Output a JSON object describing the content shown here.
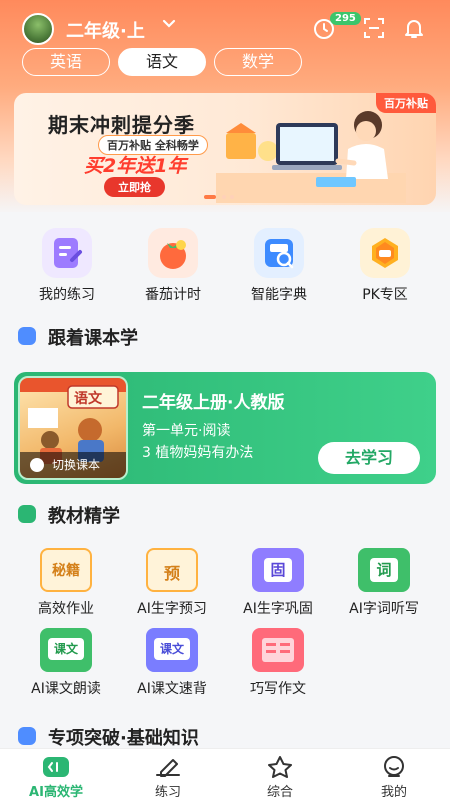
{
  "header": {
    "grade": "二年级·上",
    "coin_count": "295"
  },
  "subject_tabs": [
    {
      "label": "英语",
      "active": false
    },
    {
      "label": "语文",
      "active": true
    },
    {
      "label": "数学",
      "active": false
    }
  ],
  "banner": {
    "tag": "百万补贴",
    "title": "期末冲刺提分季",
    "subtitle": "百万补贴  全科畅学",
    "promo": "买2年送1年",
    "button": "立即抢"
  },
  "quick_actions": [
    {
      "label": "我的练习",
      "icon": "practice-icon",
      "color": "#9d7bff"
    },
    {
      "label": "番茄计时",
      "icon": "tomato-timer-icon",
      "color": "#ff6a3d"
    },
    {
      "label": "智能字典",
      "icon": "dictionary-icon",
      "color": "#3d8bff"
    },
    {
      "label": "PK专区",
      "icon": "pk-icon",
      "color": "#ffb020"
    }
  ],
  "textbook_section": {
    "title": "跟着课本学",
    "cover_title": "语文",
    "switch_label": "切换课本",
    "book_title": "二年级上册·人教版",
    "unit": "第一单元·阅读",
    "lesson": "3 植物妈妈有办法",
    "study_button": "去学习"
  },
  "intensive_section": {
    "title": "教材精学",
    "items": [
      {
        "label": "高效作业",
        "icon": "secret-book-icon",
        "icon_text": "秘籍",
        "color": "#ffb240"
      },
      {
        "label": "AI生字预习",
        "icon": "preview-icon",
        "icon_text": "预",
        "color": "#ffb240"
      },
      {
        "label": "AI生字巩固",
        "icon": "consolidate-icon",
        "icon_text": "固",
        "color": "#8f7dff"
      },
      {
        "label": "AI字词听写",
        "icon": "dictation-icon",
        "icon_text": "词",
        "color": "#3fbf6a"
      },
      {
        "label": "AI课文朗读",
        "icon": "read-aloud-icon",
        "icon_text": "课文",
        "color": "#3fbf6a"
      },
      {
        "label": "AI课文速背",
        "icon": "recite-icon",
        "icon_text": "课文",
        "color": "#7a7dff"
      },
      {
        "label": "巧写作文",
        "icon": "composition-icon",
        "icon_text": "",
        "color": "#ff6a7a"
      }
    ]
  },
  "special_section": {
    "title": "专项突破·基础知识"
  },
  "bottom_nav": [
    {
      "label": "AI高效学",
      "icon": "ai-study-icon",
      "active": true
    },
    {
      "label": "练习",
      "icon": "practice-pen-icon",
      "active": false
    },
    {
      "label": "综合",
      "icon": "star-icon",
      "active": false
    },
    {
      "label": "我的",
      "icon": "profile-icon",
      "active": false
    }
  ]
}
